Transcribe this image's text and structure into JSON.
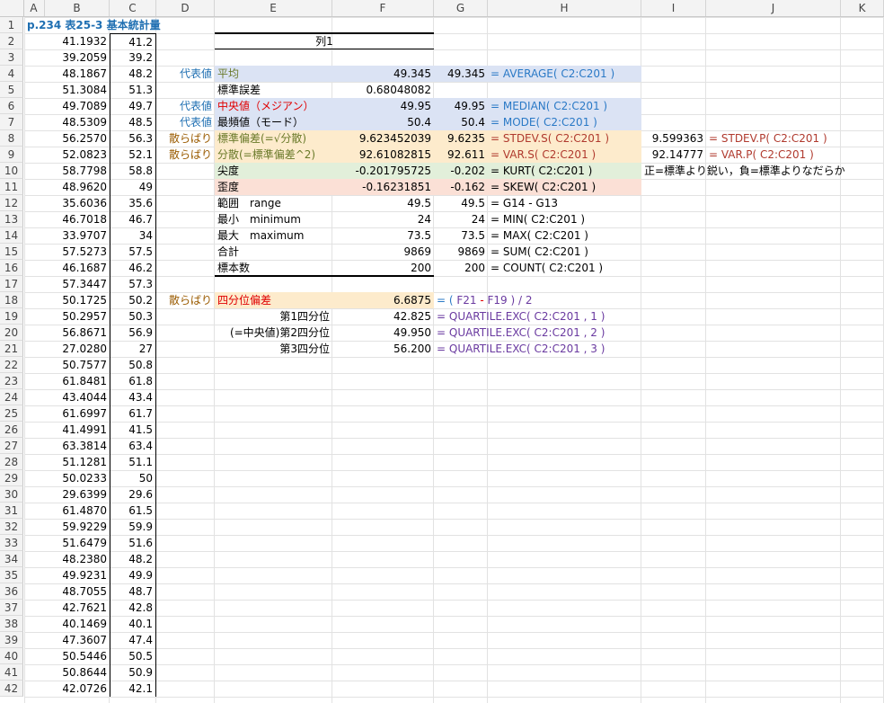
{
  "columns": [
    "A",
    "B",
    "C",
    "D",
    "E",
    "F",
    "G",
    "H",
    "I",
    "J",
    "K"
  ],
  "rows": [
    "1",
    "2",
    "3",
    "4",
    "5",
    "6",
    "7",
    "8",
    "9",
    "10",
    "11",
    "12",
    "13",
    "14",
    "15",
    "16",
    "17",
    "18",
    "19",
    "20",
    "21",
    "22",
    "23",
    "24",
    "25",
    "26",
    "27",
    "28",
    "29",
    "30",
    "31",
    "32",
    "33",
    "34",
    "35",
    "36",
    "37",
    "38",
    "39",
    "40",
    "41",
    "42"
  ],
  "title": "p.234 表25-3 基本統計量",
  "col_b": [
    "41.1932",
    "39.2059",
    "48.1867",
    "51.3084",
    "49.7089",
    "48.5309",
    "56.2570",
    "52.0823",
    "58.7798",
    "48.9620",
    "35.6036",
    "46.7018",
    "33.9707",
    "57.5273",
    "46.1687",
    "57.3447",
    "50.1725",
    "50.2957",
    "56.8671",
    "27.0280",
    "50.7577",
    "61.8481",
    "43.4044",
    "61.6997",
    "41.4991",
    "63.3814",
    "51.1281",
    "50.0233",
    "29.6399",
    "61.4870",
    "59.9229",
    "51.6479",
    "48.2380",
    "49.9231",
    "48.7055",
    "42.7621",
    "40.1469",
    "47.3607",
    "50.5446",
    "50.8644",
    "42.0726"
  ],
  "col_c": [
    "41.2",
    "39.2",
    "48.2",
    "51.3",
    "49.7",
    "48.5",
    "56.3",
    "52.1",
    "58.8",
    "49",
    "35.6",
    "46.7",
    "34",
    "57.5",
    "46.2",
    "57.3",
    "50.2",
    "50.3",
    "56.9",
    "27",
    "50.8",
    "61.8",
    "43.4",
    "61.7",
    "41.5",
    "63.4",
    "51.1",
    "50",
    "29.6",
    "61.5",
    "59.9",
    "51.6",
    "48.2",
    "49.9",
    "48.7",
    "42.8",
    "40.1",
    "47.4",
    "50.5",
    "50.9",
    "42.1"
  ],
  "stats": {
    "header": "列1",
    "d4": "代表値",
    "e4": "平均",
    "f4": "49.345",
    "g4": "49.345",
    "h4": "= AVERAGE( C2:C201 )",
    "e5": "標準誤差",
    "f5": "0.68048082",
    "d6": "代表値",
    "e6": "中央値（メジアン）",
    "f6": "49.95",
    "g6": "49.95",
    "h6": "= MEDIAN( C2:C201 )",
    "d7": "代表値",
    "e7": "最頻値（モード）",
    "f7": "50.4",
    "g7": "50.4",
    "h7": "= MODE( C2:C201 )",
    "d8": "散らばり",
    "e8": "標準偏差(=√分散)",
    "f8": "9.623452039",
    "g8": "9.6235",
    "h8": "= STDEV.S( C2:C201 )",
    "i8": "9.599363",
    "j8": "= STDEV.P( C2:C201 )",
    "d9": "散らばり",
    "e9": "分散(=標準偏差^2)",
    "f9": "92.61082815",
    "g9": "92.611",
    "h9": "= VAR.S( C2:C201 )",
    "i9": "92.14777",
    "j9": "= VAR.P( C2:C201 )",
    "e10": "尖度",
    "f10": "-0.201795725",
    "g10": "-0.202",
    "h10": "= KURT( C2:C201 )",
    "i10": "正=標準より鋭い，負=標準よりなだらか",
    "e11": "歪度",
    "f11": "-0.16231851",
    "g11": "-0.162",
    "h11": "= SKEW( C2:C201 )",
    "e12": "範囲　range",
    "f12": "49.5",
    "g12": "49.5",
    "h12": "= G14 - G13",
    "e13": "最小　minimum",
    "f13": "24",
    "g13": "24",
    "h13": "= MIN( C2:C201 )",
    "e14": "最大　maximum",
    "f14": "73.5",
    "g14": "73.5",
    "h14": "= MAX( C2:C201 )",
    "e15": "合計",
    "f15": "9869",
    "g15": "9869",
    "h15": "= SUM( C2:C201 )",
    "e16": "標本数",
    "f16": "200",
    "g16": "200",
    "h16": "= COUNT( C2:C201 )",
    "d18": "散らばり",
    "e18": "四分位偏差",
    "f18": "6.6875",
    "h18a": "= ( ",
    "h18b": "F21",
    "h18c": " - ",
    "h18d": "F19",
    "h18e": " ) / 2",
    "e19": "第1四分位",
    "f19": "42.825",
    "h19": "= QUARTILE.EXC( C2:C201 , 1 )",
    "e20": "(=中央値)第2四分位",
    "f20": "49.950",
    "h20": "= QUARTILE.EXC( C2:C201 , 2 )",
    "e21": "第3四分位",
    "f21": "56.200",
    "h21": "= QUARTILE.EXC( C2:C201 , 3 )"
  }
}
